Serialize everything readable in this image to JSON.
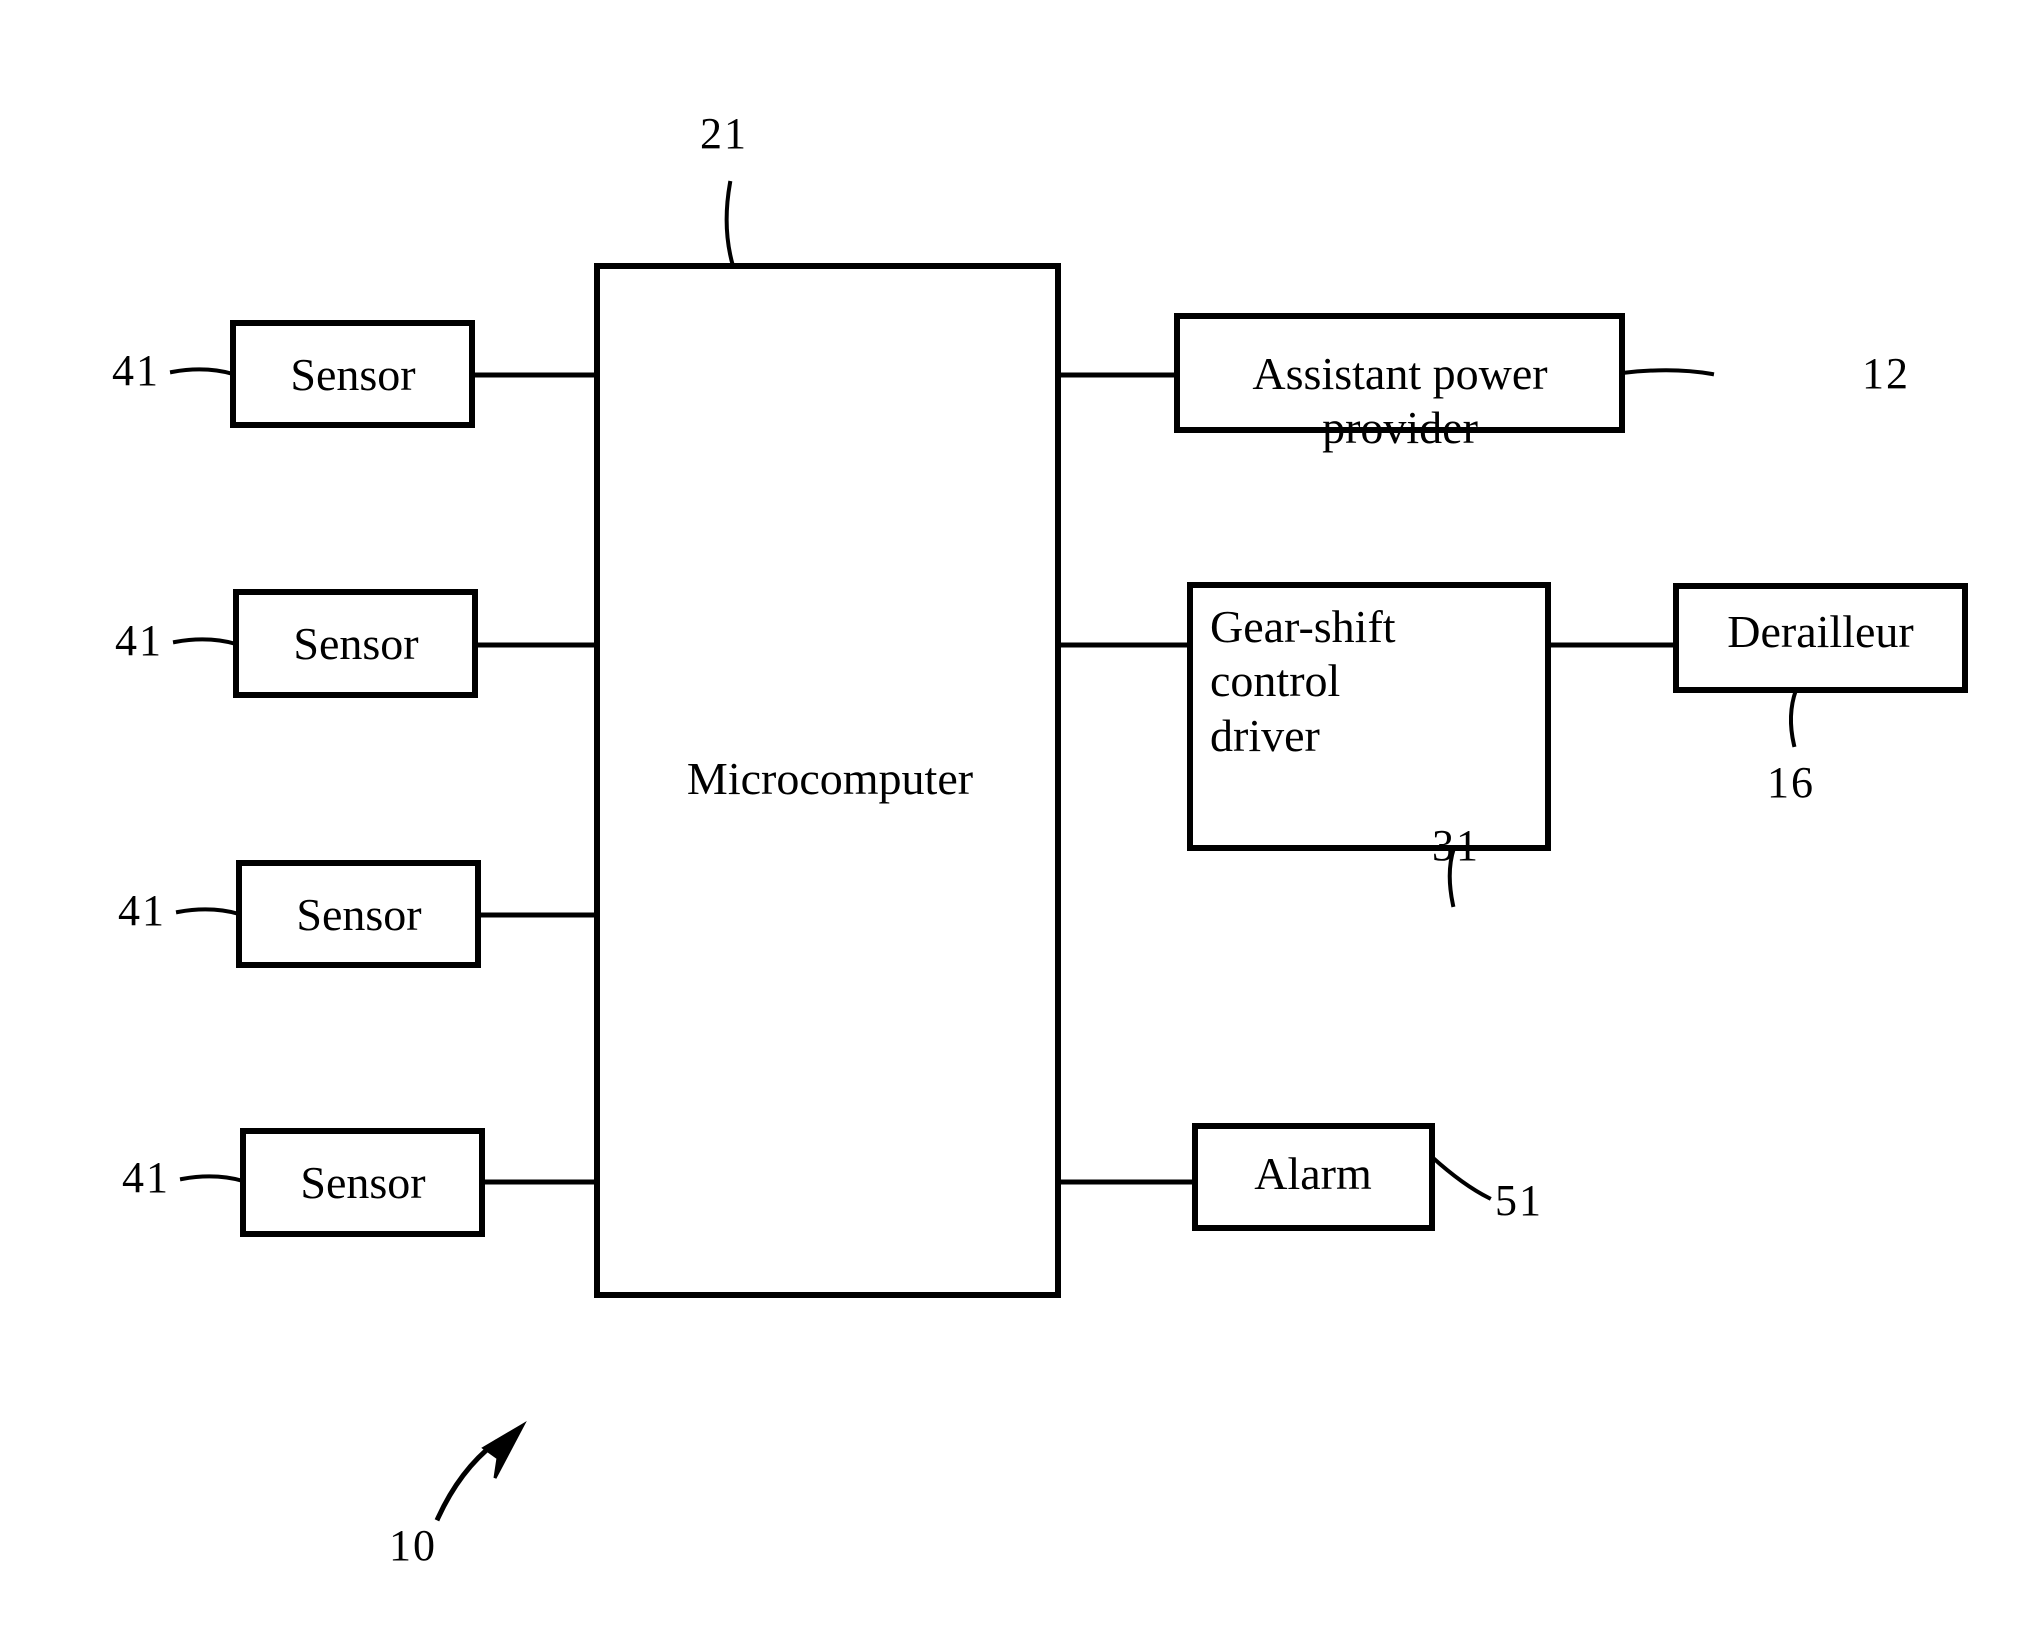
{
  "figure": {
    "type": "patent-block-diagram",
    "background_color": "#ffffff",
    "line_color": "#000000",
    "system_reference": "10"
  },
  "blocks": {
    "sensor_1": {
      "label": "Sensor",
      "ref": "41"
    },
    "sensor_2": {
      "label": "Sensor",
      "ref": "41"
    },
    "sensor_3": {
      "label": "Sensor",
      "ref": "41"
    },
    "sensor_4": {
      "label": "Sensor",
      "ref": "41"
    },
    "microcomputer": {
      "label": "Microcomputer",
      "ref": "21"
    },
    "assistant_power_provider": {
      "label": "Assistant power provider",
      "ref": "12"
    },
    "gear_shift_control_driver": {
      "label": "Gear-shift\ncontrol\ndriver",
      "ref": "31"
    },
    "derailleur": {
      "label": "Derailleur",
      "ref": "16"
    },
    "alarm": {
      "label": "Alarm",
      "ref": "51"
    }
  },
  "reference_numerals": {
    "sensor_1": "41",
    "sensor_2": "41",
    "sensor_3": "41",
    "sensor_4": "41",
    "microcomputer": "21",
    "assistant_power_provider": "12",
    "gear_shift_control_driver": "31",
    "derailleur": "16",
    "alarm": "51",
    "system": "10"
  },
  "connections": [
    {
      "from": "sensor_1",
      "to": "microcomputer"
    },
    {
      "from": "sensor_2",
      "to": "microcomputer"
    },
    {
      "from": "sensor_3",
      "to": "microcomputer"
    },
    {
      "from": "sensor_4",
      "to": "microcomputer"
    },
    {
      "from": "microcomputer",
      "to": "assistant_power_provider"
    },
    {
      "from": "microcomputer",
      "to": "gear_shift_control_driver"
    },
    {
      "from": "gear_shift_control_driver",
      "to": "derailleur"
    },
    {
      "from": "microcomputer",
      "to": "alarm"
    }
  ]
}
